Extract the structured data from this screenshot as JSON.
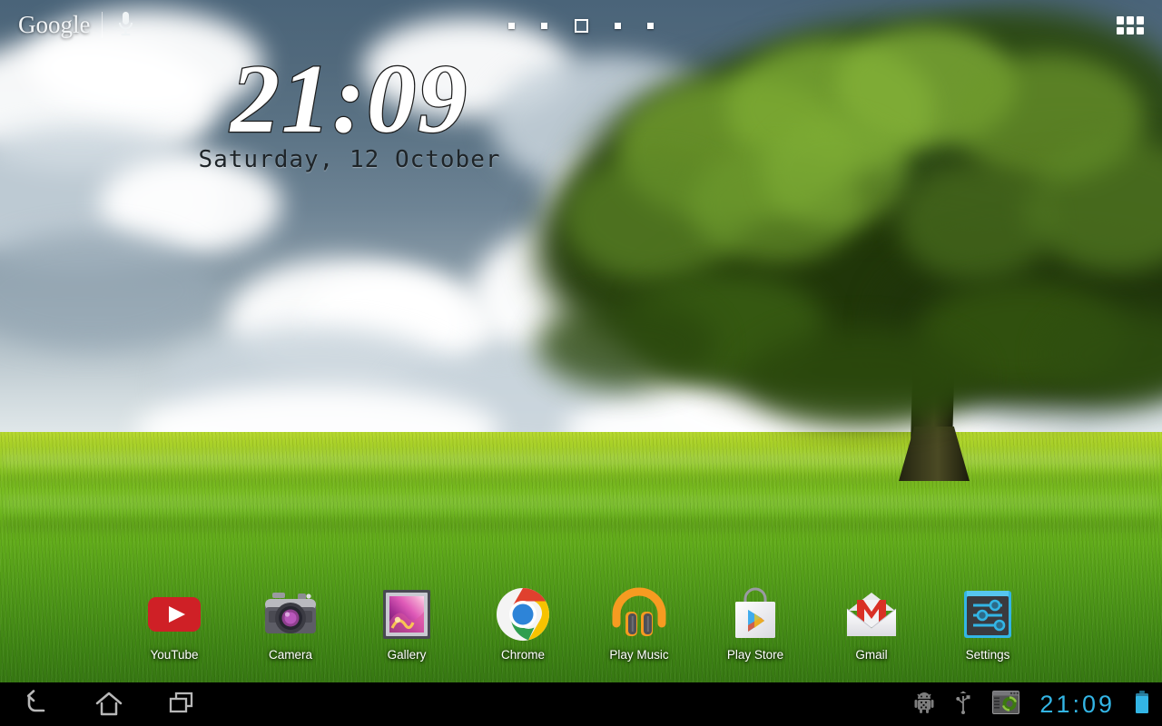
{
  "search": {
    "logo_text": "Google",
    "mic_icon": "microphone-icon",
    "divider": "search-divider"
  },
  "page_indicator": {
    "total": 5,
    "active_index": 2,
    "dots": [
      "page-1",
      "page-2",
      "page-3",
      "page-4",
      "page-5"
    ]
  },
  "apps_grid": {
    "icon": "apps-grid-icon",
    "cells": 6
  },
  "clock_widget": {
    "time": "21:09",
    "date": "Saturday, 12 October"
  },
  "dock": {
    "items": [
      {
        "label": "YouTube",
        "icon": "youtube-icon"
      },
      {
        "label": "Camera",
        "icon": "camera-icon"
      },
      {
        "label": "Gallery",
        "icon": "gallery-icon"
      },
      {
        "label": "Chrome",
        "icon": "chrome-icon"
      },
      {
        "label": "Play Music",
        "icon": "play-music-icon"
      },
      {
        "label": "Play Store",
        "icon": "play-store-icon"
      },
      {
        "label": "Gmail",
        "icon": "gmail-icon"
      },
      {
        "label": "Settings",
        "icon": "settings-icon"
      }
    ]
  },
  "system_bar": {
    "nav": [
      {
        "name": "back-button",
        "icon": "back-arrow-icon"
      },
      {
        "name": "home-button",
        "icon": "home-icon"
      },
      {
        "name": "recents-button",
        "icon": "recents-icon"
      }
    ],
    "status": [
      {
        "name": "android-debug-icon"
      },
      {
        "name": "usb-icon"
      },
      {
        "name": "sync-window-icon"
      }
    ],
    "clock": "21:09",
    "battery": "battery-full-icon"
  },
  "colors": {
    "accent_blue": "#33b5e5",
    "sky": "#5b7385",
    "grass_light": "#b6d82e",
    "grass_dark": "#357612",
    "youtube_red": "#cf2026",
    "gmail_red": "#d93025",
    "play_music_orange": "#f79b21",
    "settings_blue": "#33b5e5",
    "nav_icon_gray": "#b8b8b8"
  },
  "wallpaper": {
    "name": "tree-field-clouds-wallpaper",
    "description": "Large green tree on a grass field under cloudy sky"
  }
}
